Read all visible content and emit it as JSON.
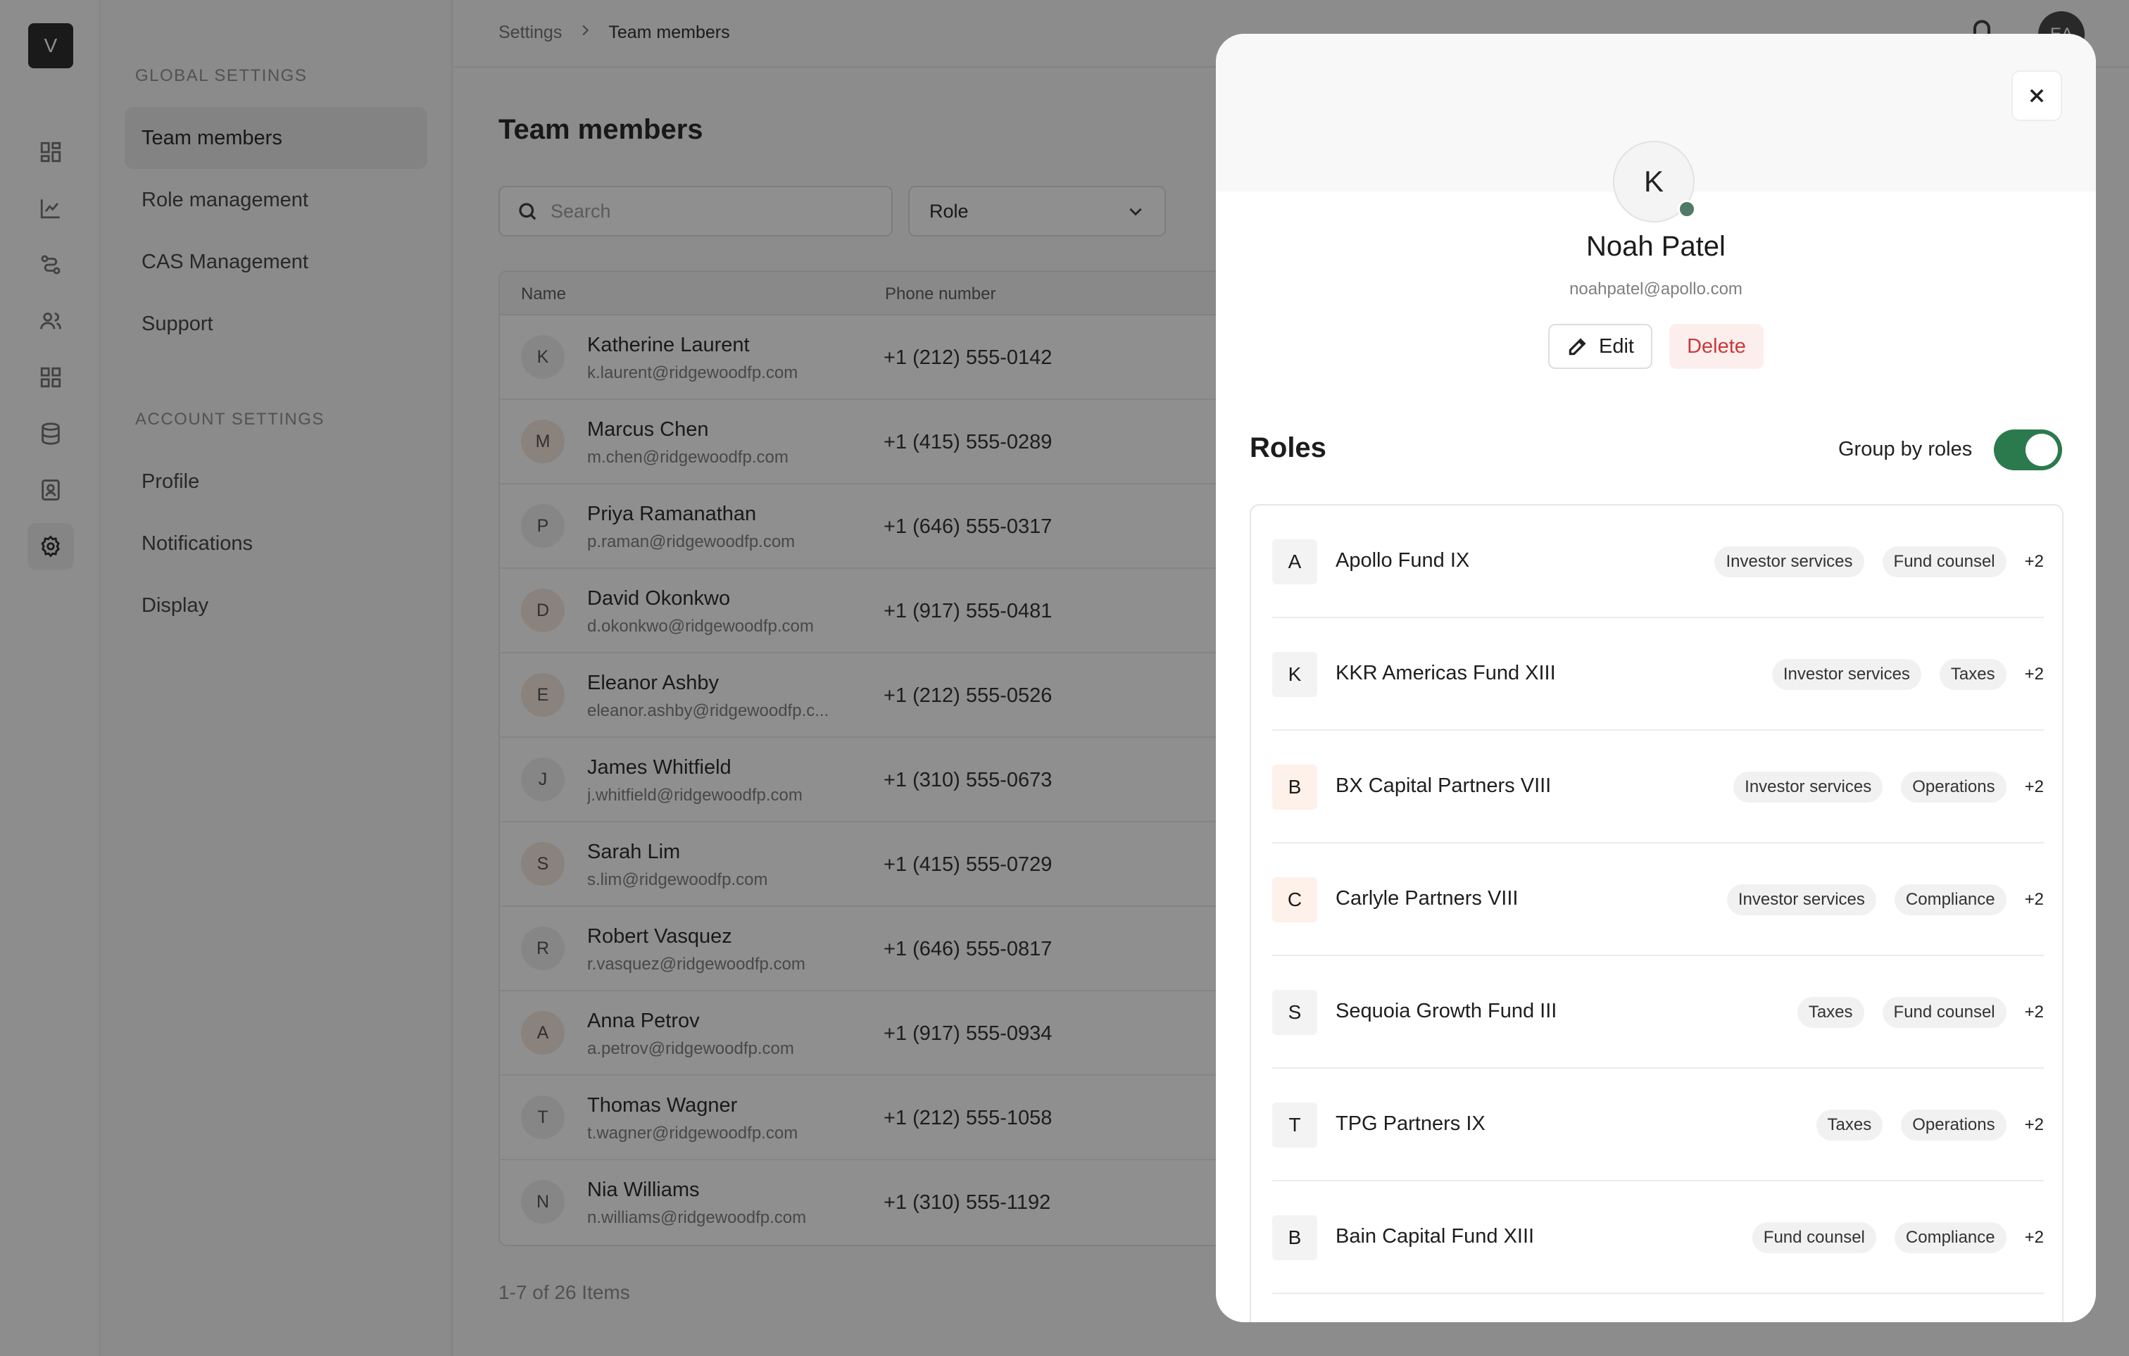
{
  "app": {
    "logo_letter": "V"
  },
  "rail": {
    "icons": [
      "dashboard-icon",
      "chart-icon",
      "workflow-icon",
      "users-icon",
      "grid-icon",
      "database-icon",
      "contacts-icon",
      "settings-icon"
    ]
  },
  "settings_nav": {
    "global_heading": "GLOBAL SETTINGS",
    "global_items": [
      "Team members",
      "Role management",
      "CAS Management",
      "Support"
    ],
    "account_heading": "ACCOUNT SETTINGS",
    "account_items": [
      "Profile",
      "Notifications",
      "Display"
    ]
  },
  "breadcrumb": {
    "root": "Settings",
    "current": "Team members"
  },
  "header": {
    "user_initials": "EA"
  },
  "page": {
    "title": "Team members",
    "search_placeholder": "Search",
    "role_filter": "Role",
    "columns": {
      "name": "Name",
      "phone": "Phone number"
    },
    "pager": "1-7 of 26 Items"
  },
  "members": [
    {
      "initial": "K",
      "name": "Katherine Laurent",
      "email": "k.laurent@ridgewoodfp.com",
      "phone": "+1 (212) 555-0142",
      "avatar_color": "#eeeeee"
    },
    {
      "initial": "M",
      "name": "Marcus Chen",
      "email": "m.chen@ridgewoodfp.com",
      "phone": "+1 (415) 555-0289",
      "avatar_color": "#f6e7dc"
    },
    {
      "initial": "P",
      "name": "Priya Ramanathan",
      "email": "p.raman@ridgewoodfp.com",
      "phone": "+1 (646) 555-0317",
      "avatar_color": "#eeeeee"
    },
    {
      "initial": "D",
      "name": "David Okonkwo",
      "email": "d.okonkwo@ridgewoodfp.com",
      "phone": "+1 (917) 555-0481",
      "avatar_color": "#f6e7dc"
    },
    {
      "initial": "E",
      "name": "Eleanor Ashby",
      "email": "eleanor.ashby@ridgewoodfp.c...",
      "phone": "+1 (212) 555-0526",
      "avatar_color": "#f6e7dc"
    },
    {
      "initial": "J",
      "name": "James Whitfield",
      "email": "j.whitfield@ridgewoodfp.com",
      "phone": "+1 (310) 555-0673",
      "avatar_color": "#eeeeee"
    },
    {
      "initial": "S",
      "name": "Sarah Lim",
      "email": "s.lim@ridgewoodfp.com",
      "phone": "+1 (415) 555-0729",
      "avatar_color": "#f6e7dc"
    },
    {
      "initial": "R",
      "name": "Robert Vasquez",
      "email": "r.vasquez@ridgewoodfp.com",
      "phone": "+1 (646) 555-0817",
      "avatar_color": "#eeeeee"
    },
    {
      "initial": "A",
      "name": "Anna Petrov",
      "email": "a.petrov@ridgewoodfp.com",
      "phone": "+1 (917) 555-0934",
      "avatar_color": "#f6e7dc"
    },
    {
      "initial": "T",
      "name": "Thomas Wagner",
      "email": "t.wagner@ridgewoodfp.com",
      "phone": "+1 (212) 555-1058",
      "avatar_color": "#eeeeee"
    },
    {
      "initial": "N",
      "name": "Nia Williams",
      "email": "n.williams@ridgewoodfp.com",
      "phone": "+1 (310) 555-1192",
      "avatar_color": "#eeeeee"
    }
  ],
  "drawer": {
    "initial": "K",
    "name": "Noah Patel",
    "email": "noahpatel@apollo.com",
    "edit_label": "Edit",
    "delete_label": "Delete",
    "roles_title": "Roles",
    "group_by_label": "Group by roles",
    "group_by_enabled": true,
    "roles": [
      {
        "badge": "A",
        "fund": "Apollo Fund IX",
        "tags": [
          "Investor services",
          "Fund counsel"
        ],
        "more": "+2",
        "badge_color": "#f3f3f3"
      },
      {
        "badge": "K",
        "fund": "KKR Americas Fund XIII",
        "tags": [
          "Investor services",
          "Taxes"
        ],
        "more": "+2",
        "badge_color": "#f3f3f3"
      },
      {
        "badge": "B",
        "fund": "BX Capital Partners VIII",
        "tags": [
          "Investor services",
          "Operations"
        ],
        "more": "+2",
        "badge_color": "#fdf1ea"
      },
      {
        "badge": "C",
        "fund": "Carlyle Partners VIII",
        "tags": [
          "Investor services",
          "Compliance"
        ],
        "more": "+2",
        "badge_color": "#fdf1ea"
      },
      {
        "badge": "S",
        "fund": "Sequoia Growth Fund III",
        "tags": [
          "Taxes",
          "Fund counsel"
        ],
        "more": "+2",
        "badge_color": "#f3f3f3"
      },
      {
        "badge": "T",
        "fund": "TPG Partners IX",
        "tags": [
          "Taxes",
          "Operations"
        ],
        "more": "+2",
        "badge_color": "#f3f3f3"
      },
      {
        "badge": "B",
        "fund": "Bain Capital Fund XIII",
        "tags": [
          "Fund counsel",
          "Compliance"
        ],
        "more": "+2",
        "badge_color": "#f3f3f3"
      }
    ]
  },
  "colors": {
    "toggle_on": "#2b7a4d",
    "delete_text": "#c93a3a",
    "delete_bg": "#fdeeee",
    "presence": "#4e7a66"
  }
}
